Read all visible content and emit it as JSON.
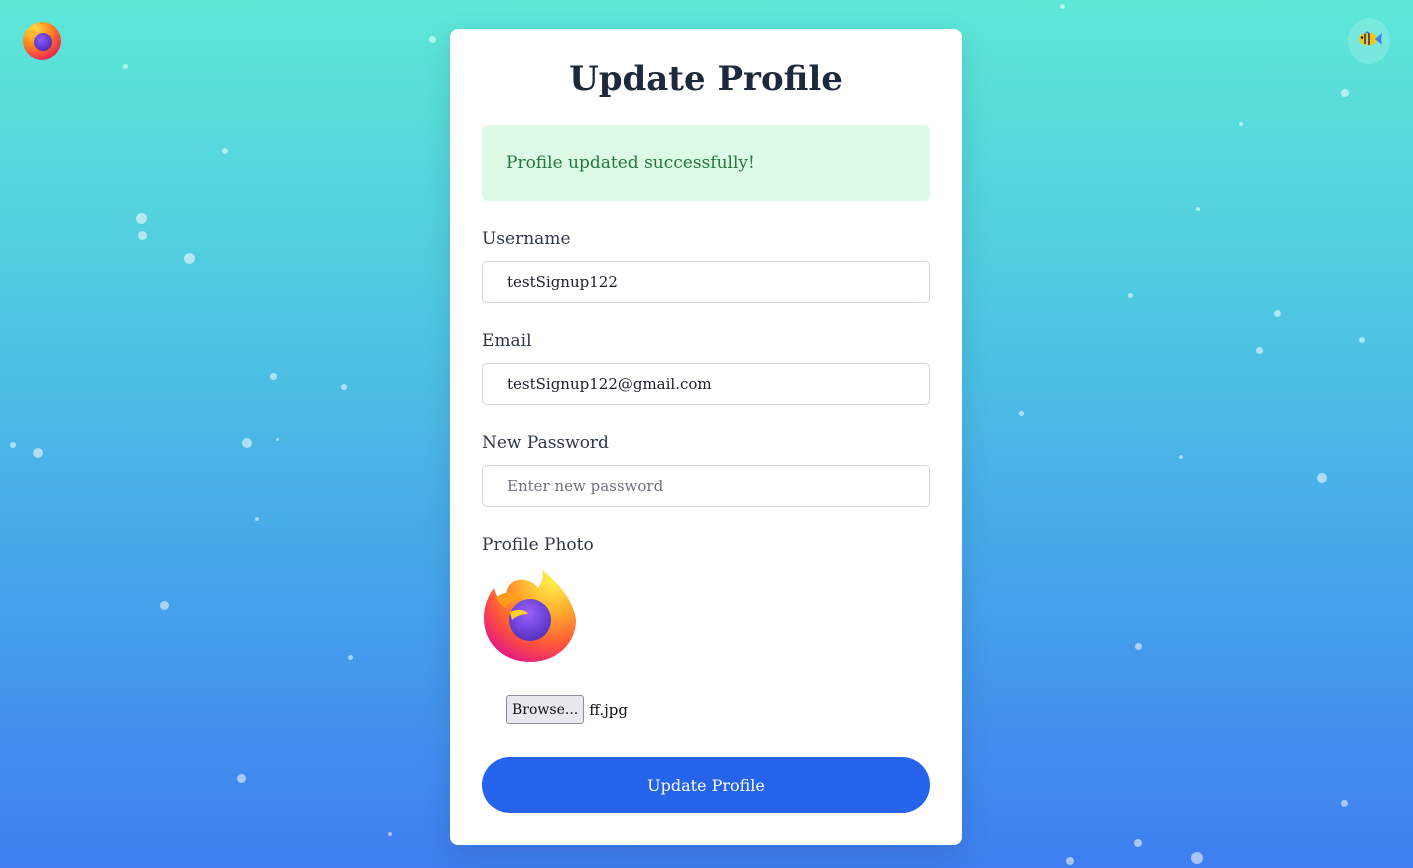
{
  "page": {
    "title": "Update Profile",
    "alert_message": "Profile updated successfully!",
    "colors": {
      "accent": "#2563eb",
      "success_bg": "#dcfae6",
      "success_text": "#1f7a3a"
    }
  },
  "header": {
    "logo_icon": "firefox-logo-icon",
    "theme_button_icon": "fish-icon"
  },
  "form": {
    "username": {
      "label": "Username",
      "value": "testSignup122"
    },
    "email": {
      "label": "Email",
      "value": "testSignup122@gmail.com"
    },
    "new_password": {
      "label": "New Password",
      "value": "",
      "placeholder": "Enter new password"
    },
    "profile_photo": {
      "label": "Profile Photo",
      "browse_label": "Browse...",
      "file_name": "ff.jpg"
    },
    "submit_label": "Update Profile"
  }
}
